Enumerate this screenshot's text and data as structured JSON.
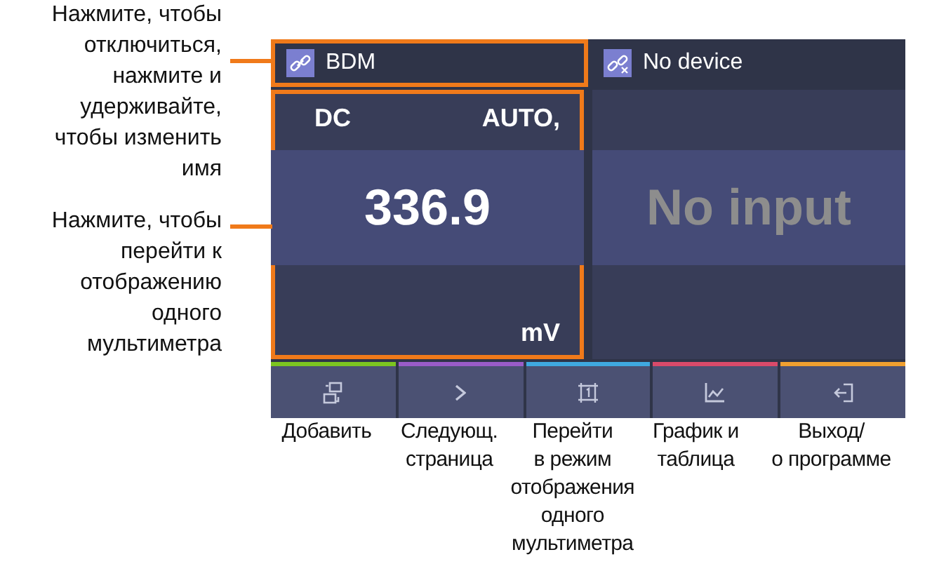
{
  "callouts": [
    {
      "lines": [
        "Нажмите, чтобы",
        "отключиться,",
        "нажмите и",
        "удерживайте,",
        "чтобы изменить",
        "имя"
      ]
    },
    {
      "lines": [
        "Нажмите, чтобы",
        "перейти к",
        "отображению",
        "одного",
        "мультиметра"
      ]
    }
  ],
  "devices": [
    {
      "name": "BDM",
      "connected": true,
      "highlighted": true,
      "mode": "DC",
      "range": "AUTO,",
      "reading": "336.9",
      "unit": "mV"
    },
    {
      "name": "No device",
      "connected": false,
      "highlighted": false,
      "reading": "No input"
    }
  ],
  "toolbar": [
    {
      "kind": "add",
      "color": "#7cc520"
    },
    {
      "kind": "next",
      "color": "#9a5cc8"
    },
    {
      "kind": "single",
      "color": "#3fa9e0"
    },
    {
      "kind": "chart",
      "color": "#d94a6a"
    },
    {
      "kind": "exit",
      "color": "#f0a030"
    }
  ],
  "captions": [
    {
      "lines": [
        "Добавить"
      ]
    },
    {
      "lines": [
        "Следующ.",
        "страница"
      ]
    },
    {
      "lines": [
        "Перейти",
        "в режим",
        "отображения",
        "одного",
        "мультиметра"
      ]
    },
    {
      "lines": [
        "График и",
        "таблица"
      ]
    },
    {
      "lines": [
        "Выход/",
        "о программе"
      ]
    }
  ]
}
